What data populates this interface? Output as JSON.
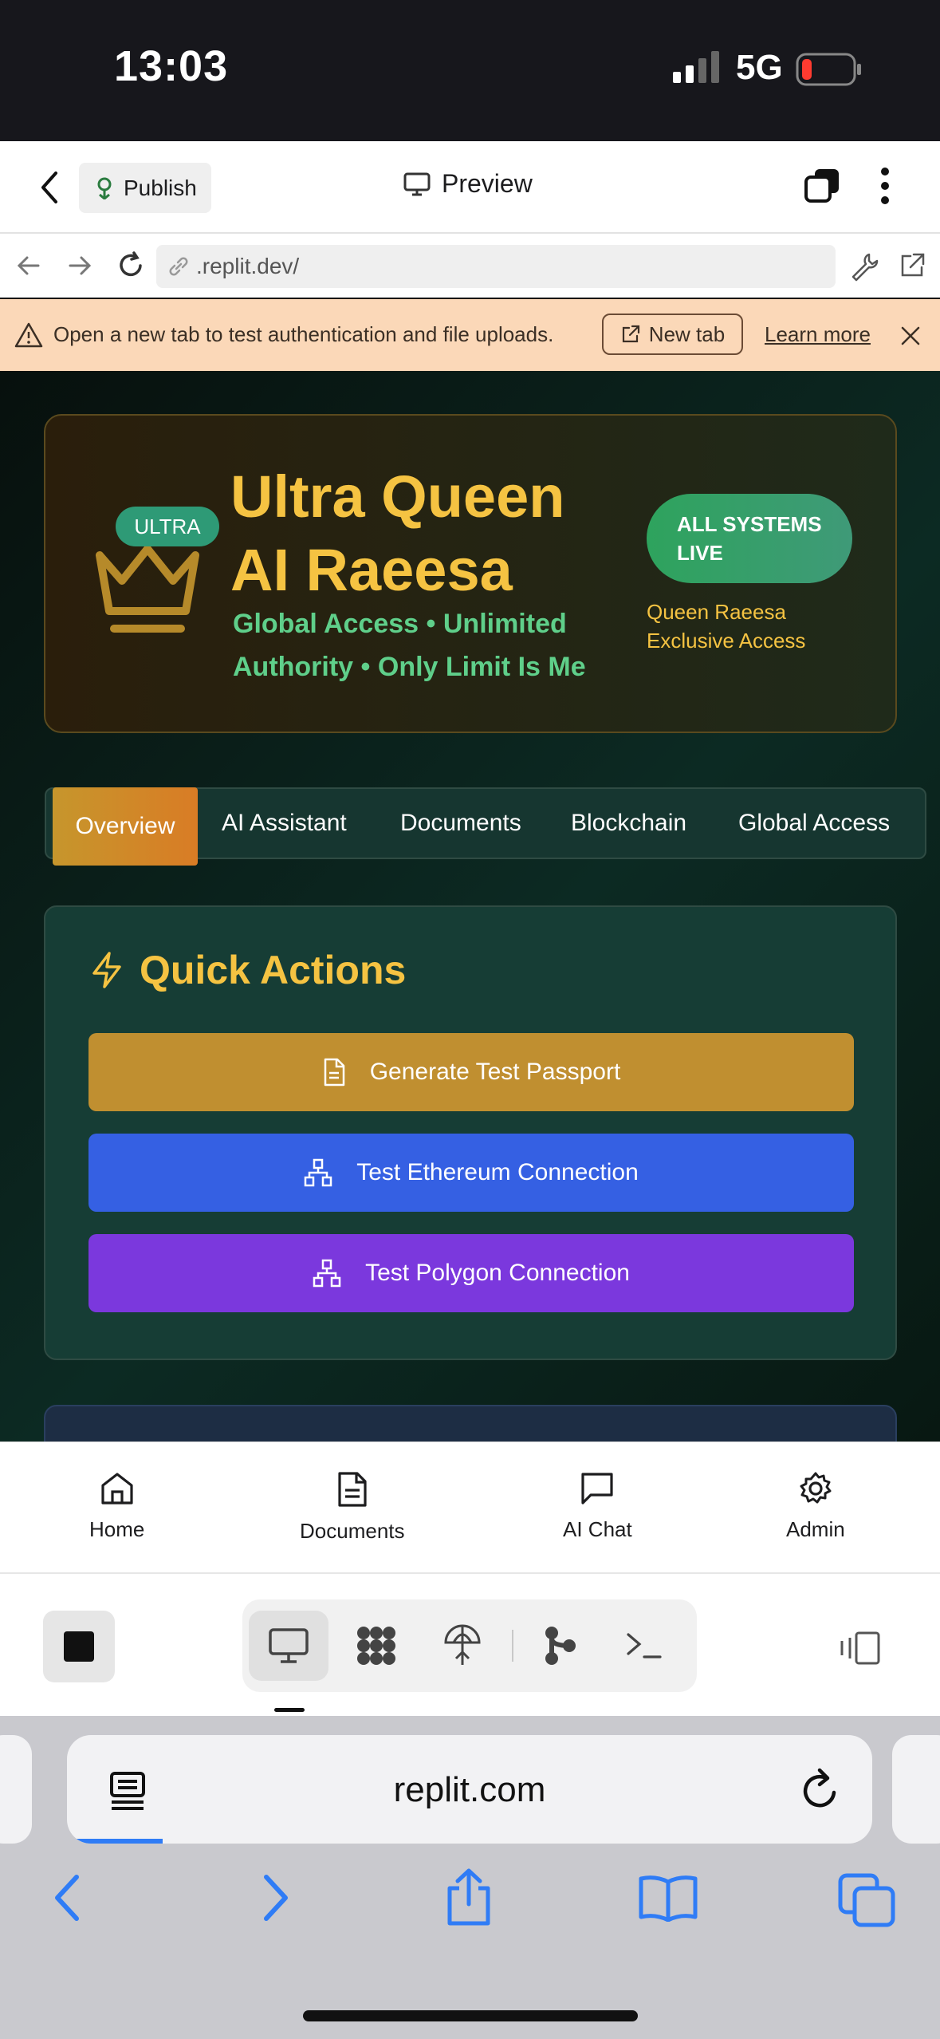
{
  "status_bar": {
    "time": "13:03",
    "network": "5G"
  },
  "header": {
    "publish_label": "Publish",
    "preview_label": "Preview"
  },
  "url_bar": {
    "url": ".replit.dev/"
  },
  "notice": {
    "message": "Open a new tab to test authentication and file uploads.",
    "new_tab_label": "New tab",
    "learn_more_label": "Learn more"
  },
  "hero": {
    "badge": "ULTRA",
    "title": "Ultra Queen AI Raeesa",
    "subtitle": "Global Access • Unlimited Authority • Only Limit Is Me",
    "status_pill": "ALL SYSTEMS LIVE",
    "access_note": "Queen Raeesa Exclusive Access"
  },
  "tabs": [
    {
      "label": "Overview",
      "active": true
    },
    {
      "label": "AI Assistant",
      "active": false
    },
    {
      "label": "Documents",
      "active": false
    },
    {
      "label": "Blockchain",
      "active": false
    },
    {
      "label": "Global Access",
      "active": false
    }
  ],
  "quick_actions": {
    "heading": "Quick Actions",
    "buttons": [
      {
        "label": "Generate Test Passport",
        "icon": "document-icon",
        "color": "#c08f30"
      },
      {
        "label": "Test Ethereum Connection",
        "icon": "network-icon",
        "color": "#3560e3"
      },
      {
        "label": "Test Polygon Connection",
        "icon": "network-icon",
        "color": "#7b38dd"
      }
    ]
  },
  "bottom_nav": [
    {
      "label": "Home",
      "icon": "home-icon"
    },
    {
      "label": "Documents",
      "icon": "document-icon"
    },
    {
      "label": "AI Chat",
      "icon": "chat-icon"
    },
    {
      "label": "Admin",
      "icon": "gear-icon"
    }
  ],
  "safari": {
    "domain": "replit.com"
  },
  "colors": {
    "gold": "#f5c342",
    "green": "#5fcf8a",
    "accent_blue": "#2f7cf6"
  }
}
